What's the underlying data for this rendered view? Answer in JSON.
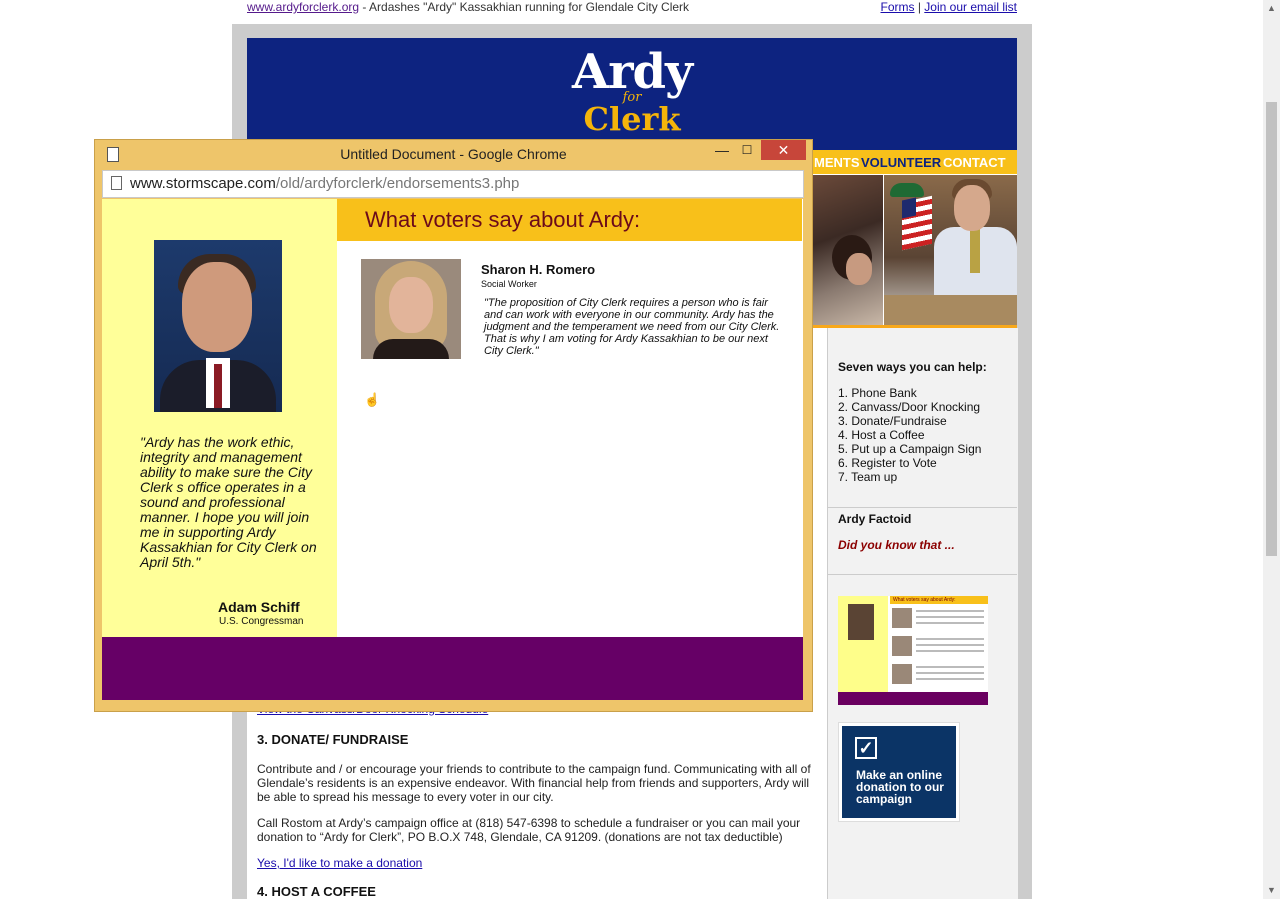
{
  "top": {
    "site_link": "www.ardyforclerk.org",
    "tagline": " - Ardashes \"Ardy\" Kassakhian running for Glendale City Clerk",
    "forms_link": "Forms",
    "sep": " | ",
    "email_link": "Join our email list"
  },
  "logo": {
    "ardy": "Ardy",
    "star": "★",
    "for": "for",
    "clerk": "Clerk"
  },
  "nav": {
    "endorsements": "MENTS",
    "volunteer": "VOLUNTEER",
    "contact": "CONTACT"
  },
  "sidebar": {
    "help_title": "Seven ways you can help:",
    "help_items": [
      "1. Phone Bank",
      "2. Canvass/Door Knocking",
      "3. Donate/Fundraise",
      "4. Host a Coffee",
      "5. Put up a Campaign Sign",
      "6. Register to Vote",
      "7. Team up"
    ],
    "factoid_title": "Ardy Factoid",
    "factoid_text": "Did you know that ...",
    "thumb_header": "What voters say about Ardy:",
    "donate_text": "Make an online donation to our campaign",
    "donate_check": "✓"
  },
  "main": {
    "canvass_link": "View the Canvass/Door Knocking Schedule",
    "donate_heading": "3. DONATE/ FUNDRAISE",
    "donate_p1": "Contribute and / or encourage your friends to contribute to the campaign fund. Communicating with all of Glendale’s residents is an expensive endeavor. With financial help from friends and supporters, Ardy will be able to spread his message to every voter in our city.",
    "donate_p2": "Call Rostom at Ardy’s campaign office at (818) 547-6398 to schedule a fundraiser or you can mail your donation to “Ardy for Clerk”, PO B.O.X 748, Glendale, CA 91209. (donations are not tax deductible)",
    "donate_link": "Yes, I'd like to make a donation",
    "coffee_heading": "4. HOST A COFFEE"
  },
  "popup": {
    "title": "Untitled Document - Google Chrome",
    "minimize": "—",
    "maximize": "☐",
    "close": "✕",
    "url_host": "www.stormscape.com",
    "url_path": "/old/ardyforclerk/endorsements3.php",
    "header": "What voters say about Ardy:",
    "schiff_quote": "\"Ardy has the work ethic, integrity and management ability to make sure the City Clerk s office operates in a sound and professional manner. I hope you will join me in supporting Ardy Kassakhian for City Clerk on April 5th.\"",
    "schiff_name": "Adam Schiff",
    "schiff_role": "U.S. Congressman",
    "romero_name": "Sharon H. Romero",
    "romero_role": "Social Worker",
    "romero_quote": "\"The proposition of City Clerk requires a person who is fair and can work with everyone in our community. Ardy has the judgment and the temperament we need from our City Clerk. That is why I am voting for Ardy Kassakhian to be our next City Clerk.\"",
    "cursor_glyph": "☝"
  },
  "colors": {
    "banner": "#0d2380",
    "gold": "#f8c01a",
    "popup_frame": "#eec56a",
    "yellow_panel": "#ffff99",
    "purple_footer": "#660066",
    "close_red": "#c7463a"
  }
}
